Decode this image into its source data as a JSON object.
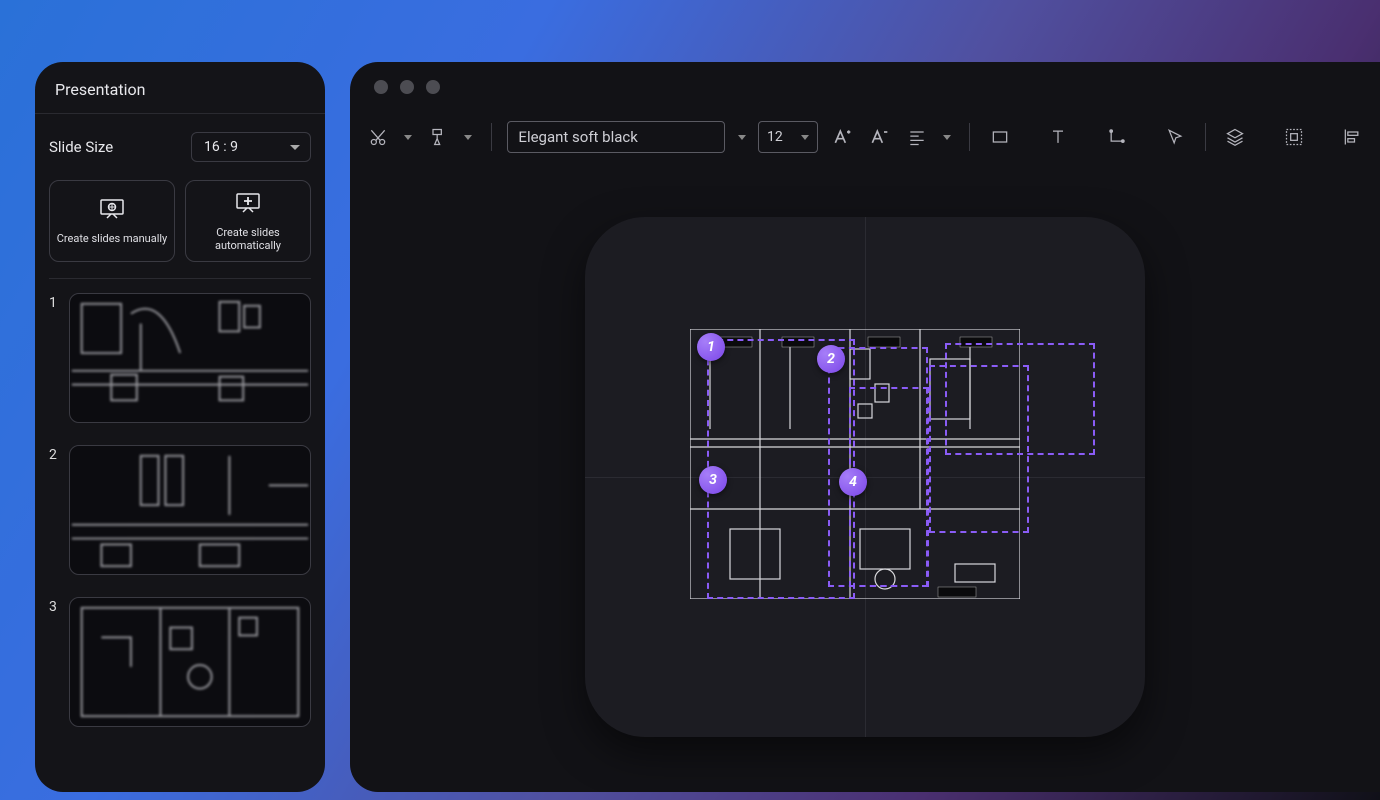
{
  "sidebar": {
    "title": "Presentation",
    "slide_size_label": "Slide Size",
    "slide_size_value": "16 : 9",
    "create_manual_label": "Create slides manually",
    "create_auto_label": "Create slides automatically",
    "thumbnails": [
      {
        "index": "1"
      },
      {
        "index": "2"
      },
      {
        "index": "3"
      }
    ]
  },
  "toolbar": {
    "font_name": "Elegant soft black",
    "font_size": "12"
  },
  "canvas": {
    "markers": [
      {
        "label": "1"
      },
      {
        "label": "2"
      },
      {
        "label": "3"
      },
      {
        "label": "4"
      }
    ]
  }
}
